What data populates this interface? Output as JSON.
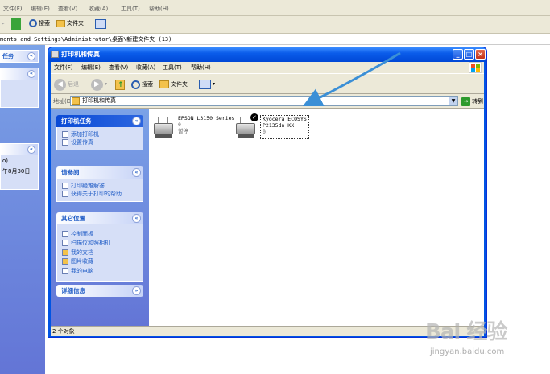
{
  "background": {
    "menu": [
      "文件(F)",
      "编辑(E)",
      "查看(V)",
      "收藏(A)",
      "工具(T)",
      "帮助(H)"
    ],
    "search_label": "搜索",
    "folders_label": "文件夹",
    "address": "ments and Settings\\Administrator\\桌面\\新建文件夹 (13)",
    "panel1_label": "任务",
    "panel3_lines": [
      "o)",
      "午8月30日,"
    ]
  },
  "window": {
    "title": "打印机和传真",
    "menu": [
      "文件(F)",
      "编辑(E)",
      "查看(V)",
      "收藏(A)",
      "工具(T)",
      "帮助(H)"
    ],
    "toolbar": {
      "back": "后退",
      "search": "搜索",
      "folders": "文件夹"
    },
    "address_label": "地址(D)",
    "address_value": "打印机和传真",
    "go_label": "转到",
    "task_panes": [
      {
        "title": "打印机任务",
        "items": [
          "添加打印机",
          "设置传真"
        ]
      },
      {
        "title": "请参阅",
        "items": [
          "打印疑难解答",
          "获得关于打印的帮助"
        ]
      },
      {
        "title": "其它位置",
        "items": [
          "控制面板",
          "扫描仪和照相机",
          "我的文档",
          "图片收藏",
          "我的电脑"
        ]
      },
      {
        "title": "详细信息",
        "items": []
      }
    ],
    "printers": [
      {
        "name": "EPSON L3150 Series",
        "count": "0",
        "status": "暂停"
      },
      {
        "name": "Kyocera ECOSYS",
        "name2": "P2135dn KX",
        "count": "0"
      }
    ],
    "status": "2 个对象"
  },
  "watermark": {
    "brand": "Bai 经验",
    "url": "jingyan.baidu.com"
  },
  "colors": {
    "xp_blue": "#0054e3",
    "task_blue": "#6375d6",
    "accent_arrow": "#3b8fd6"
  }
}
